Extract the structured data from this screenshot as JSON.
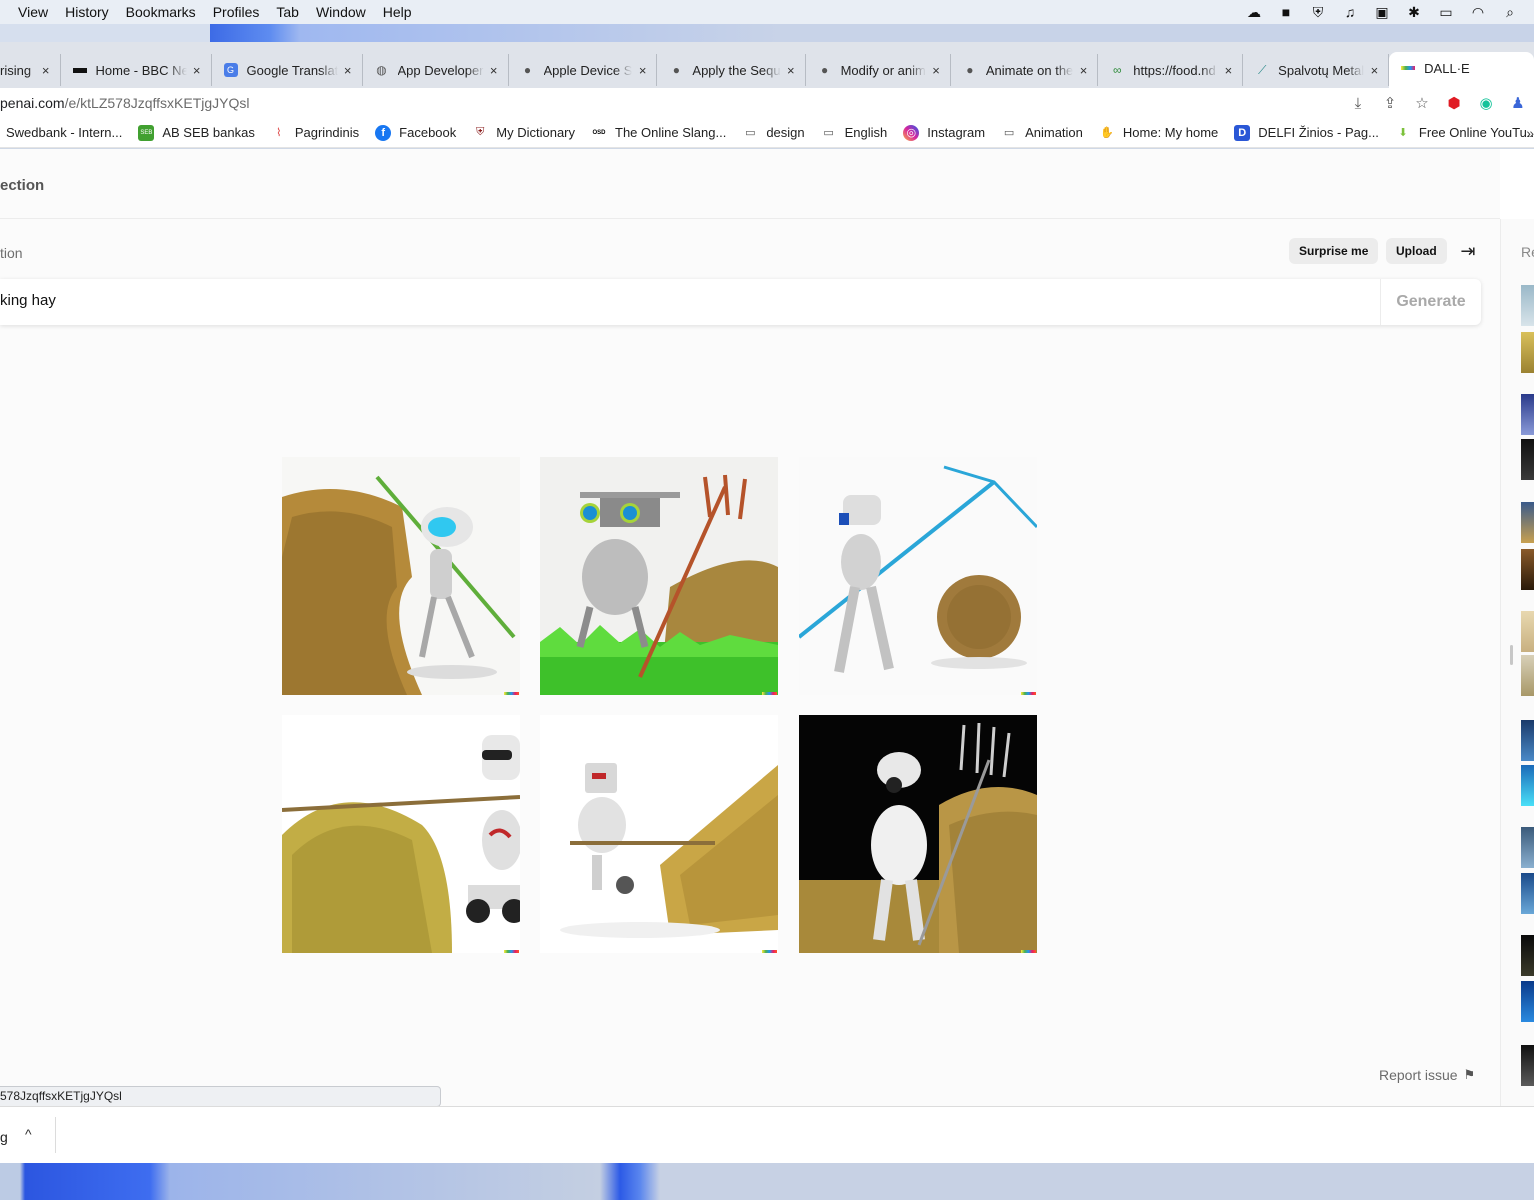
{
  "menubar": {
    "items": [
      "View",
      "History",
      "Bookmarks",
      "Profiles",
      "Tab",
      "Window",
      "Help"
    ]
  },
  "tabs": [
    {
      "title": "rising",
      "icon": "page-icon"
    },
    {
      "title": "Home - BBC News",
      "icon": "bbc-icon"
    },
    {
      "title": "Google Translate",
      "icon": "google-translate-icon"
    },
    {
      "title": "App Developer",
      "icon": "globe-icon"
    },
    {
      "title": "Apple Device S",
      "icon": "apple-icon"
    },
    {
      "title": "Apply the Sequ",
      "icon": "apple-icon"
    },
    {
      "title": "Modify or anim",
      "icon": "apple-icon"
    },
    {
      "title": "Animate on the",
      "icon": "apple-icon"
    },
    {
      "title": "https://food.nd",
      "icon": "link-icon"
    },
    {
      "title": "Spalvotų Metal",
      "icon": "metal-icon"
    },
    {
      "title": "DALL·E",
      "icon": "dalle-icon"
    }
  ],
  "tab_close_glyph": "×",
  "address": {
    "host": "penai.com",
    "path": "/e/ktLZ578JzqffsxKETjgJYQsl"
  },
  "bookmarks": [
    {
      "label": "Swedbank - Intern...",
      "icon": "none",
      "color": "#ffffff"
    },
    {
      "label": "AB SEB bankas",
      "icon": "seb-icon",
      "color": "#41a030"
    },
    {
      "label": "Pagrindinis",
      "icon": "leaf-icon",
      "color": "#ffffff"
    },
    {
      "label": "Facebook",
      "icon": "facebook-icon",
      "color": "#1877f2"
    },
    {
      "label": "My Dictionary",
      "icon": "shield-crest-icon",
      "color": "#8b1f1f"
    },
    {
      "label": "The Online Slang...",
      "icon": "osd-icon",
      "color": "#ffffff"
    },
    {
      "label": "design",
      "icon": "folder-icon",
      "color": "#ffffff"
    },
    {
      "label": "English",
      "icon": "folder-icon",
      "color": "#ffffff"
    },
    {
      "label": "Instagram",
      "icon": "instagram-icon",
      "color": "#d6249f"
    },
    {
      "label": "Animation",
      "icon": "folder-icon",
      "color": "#ffffff"
    },
    {
      "label": "Home: My home",
      "icon": "hand-icon",
      "color": "#ffffff"
    },
    {
      "label": "DELFI Žinios - Pag...",
      "icon": "delfi-icon",
      "color": "#2a57d6"
    },
    {
      "label": "Free Online YouTu...",
      "icon": "download-arrow-icon",
      "color": "#ffffff"
    }
  ],
  "bookmarks_more": "»",
  "page": {
    "title": "ection",
    "prompt_label": "tion",
    "surprise_label": "Surprise me",
    "upload_label": "Upload",
    "prompt_text": "king hay",
    "generate_label": "Generate",
    "report_label": "Report issue",
    "recent_label": "Re"
  },
  "status_url": "578JzqffsxKETjgJYQsl",
  "downloads": {
    "name": "g",
    "chevron": "^"
  },
  "colors": {
    "accent_gray": "#ececec",
    "page_bg": "#fbfbfb"
  }
}
